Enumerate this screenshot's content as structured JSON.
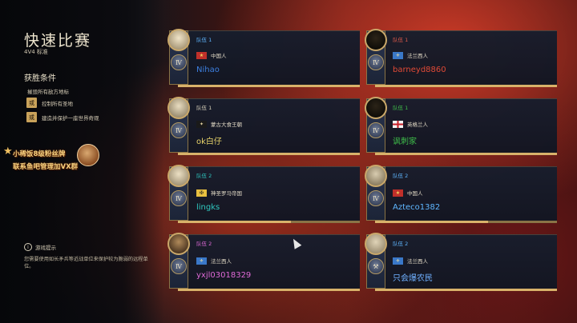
{
  "header": {
    "title": "快速比赛",
    "subtitle": "4V4 标准"
  },
  "victory": {
    "heading": "获胜条件",
    "condition_1": "摧毁所有敌方地标",
    "or_label": "或",
    "condition_2": "控制所有圣地",
    "condition_3": "建造并保护一座世界奇观"
  },
  "promo": {
    "line1": "小稀饭8级粉丝牌",
    "line2": "联系鱼吧管理加VX群",
    "star": "★"
  },
  "tip": {
    "icon": "i",
    "title": "游戏提示",
    "text": "您需要使用如长矛兵等近战单位来保护较为脆弱的远程单位。"
  },
  "colors": {
    "blue": "#3d7fe0",
    "red": "#e04a36",
    "green": "#3fbf4a",
    "teal": "#2fc8c0",
    "pink": "#e06ad8",
    "yellow": "#e8d36a",
    "team1": "#d9d2bc",
    "team2": "#5fb6ff"
  },
  "age_label": "Ⅳ",
  "players": [
    {
      "team": "队伍 1",
      "team_color": "#5fb6ff",
      "civ": "中国人",
      "flag": "china-flag",
      "name": "Nihao",
      "name_color": "#3d7fe0"
    },
    {
      "team": "队伍 1",
      "team_color": "#e05a4a",
      "civ": "法兰西人",
      "flag": "france-flag",
      "name": "barneyd8860",
      "name_color": "#e04a36"
    },
    {
      "team": "队伍 1",
      "team_color": "#d9d2bc",
      "civ": "蒙古大食王朝",
      "flag": "abbasid-flag",
      "name": "ok白仔",
      "name_color": "#e8d36a"
    },
    {
      "team": "队伍 1",
      "team_color": "#3fbf4a",
      "civ": "英格兰人",
      "flag": "england-flag",
      "name": "讽刺家",
      "name_color": "#3fbf4a"
    },
    {
      "team": "队伍 2",
      "team_color": "#2fc8c0",
      "civ": "神圣罗马帝国",
      "flag": "hre-flag",
      "name": "lingks",
      "name_color": "#2fc8c0"
    },
    {
      "team": "队伍 2",
      "team_color": "#5fb6ff",
      "civ": "中国人",
      "flag": "china-flag",
      "name": "Azteco1382",
      "name_color": "#5fb6ff"
    },
    {
      "team": "队伍 2",
      "team_color": "#e06ad8",
      "civ": "法兰西人",
      "flag": "france-flag",
      "name": "yxjl03018329",
      "name_color": "#e06ad8"
    },
    {
      "team": "队伍 2",
      "team_color": "#5fb6ff",
      "civ": "法兰西人",
      "flag": "france-flag",
      "name": "只会爆农民",
      "name_color": "#6fb0ff"
    }
  ]
}
